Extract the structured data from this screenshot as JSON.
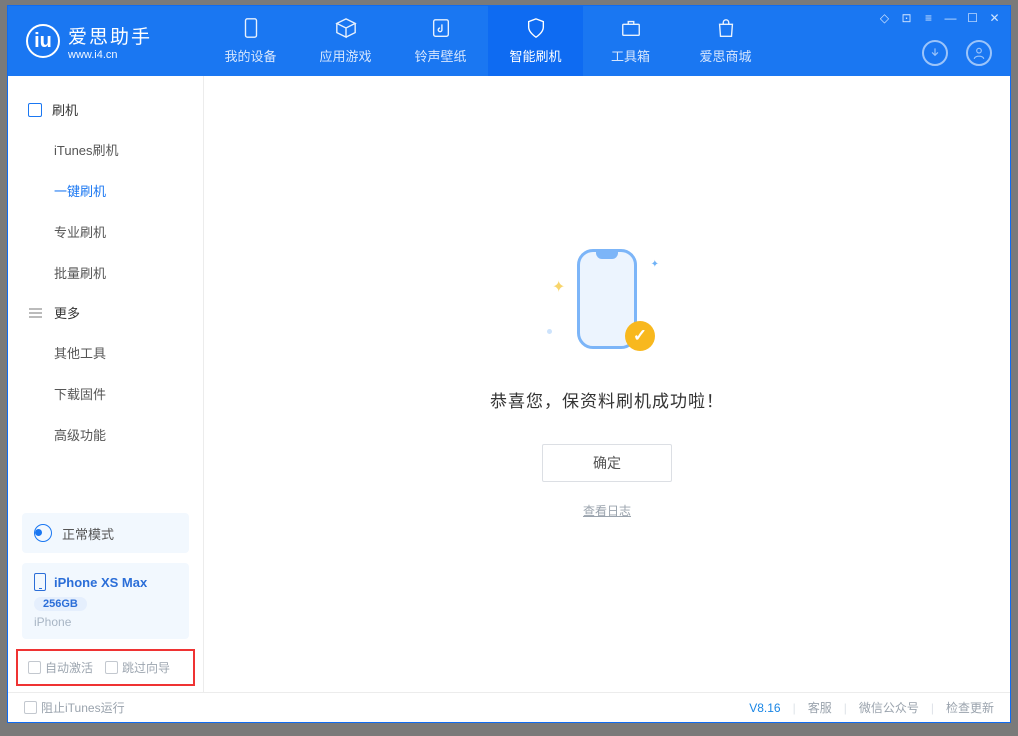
{
  "app": {
    "title": "爱思助手",
    "subtitle": "www.i4.cn"
  },
  "tabs": {
    "device": "我的设备",
    "apps": "应用游戏",
    "ring": "铃声壁纸",
    "flash": "智能刷机",
    "tools": "工具箱",
    "store": "爱思商城"
  },
  "sidebar": {
    "section_flash": "刷机",
    "items_flash": {
      "itunes": "iTunes刷机",
      "onekey": "一键刷机",
      "pro": "专业刷机",
      "batch": "批量刷机"
    },
    "section_more": "更多",
    "items_more": {
      "other": "其他工具",
      "firmware": "下载固件",
      "advanced": "高级功能"
    }
  },
  "mode": {
    "label": "正常模式"
  },
  "device": {
    "name": "iPhone XS Max",
    "storage": "256GB",
    "type": "iPhone"
  },
  "footer_checks": {
    "auto_activate": "自动激活",
    "skip_guide": "跳过向导"
  },
  "main": {
    "success": "恭喜您，保资料刷机成功啦！",
    "ok": "确定",
    "view_log": "查看日志"
  },
  "status": {
    "block_itunes": "阻止iTunes运行",
    "version": "V8.16",
    "support": "客服",
    "wechat": "微信公众号",
    "update": "检查更新"
  }
}
